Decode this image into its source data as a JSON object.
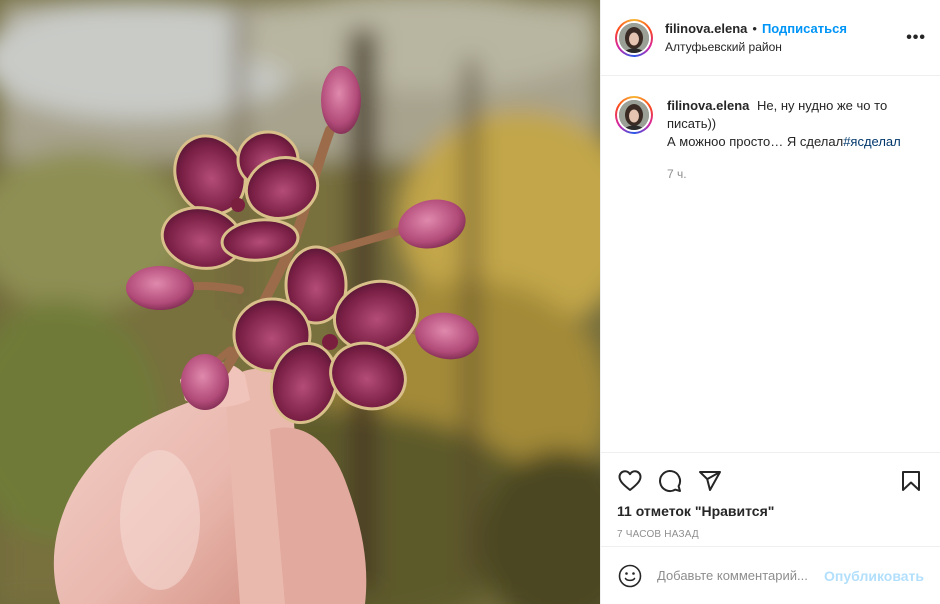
{
  "post": {
    "username": "filinova.elena",
    "follow_label": "Подписаться",
    "separator": "•",
    "location": "Алтуфьевский район",
    "more_label": "•••",
    "caption": {
      "username": "filinova.elena",
      "text_line1": "Не, ну нудно же чо то писать))",
      "text_line2": "А можноо просто… Я сделал",
      "hashtag": "#ясделал",
      "time_ago": "7 ч."
    },
    "likes": "11 отметок \"Нравится\"",
    "posted": "7 часов назад",
    "comment_placeholder": "Добавьте комментарий...",
    "publish_label": "Опубликовать",
    "icons": [
      "heart-icon",
      "comment-icon",
      "share-icon",
      "bookmark-icon",
      "emoji-icon"
    ]
  },
  "colors": {
    "accent_link": "#0095f6",
    "hashtag": "#00376b",
    "publish_disabled": "#b2dffc",
    "muted": "#8e8e8e"
  }
}
